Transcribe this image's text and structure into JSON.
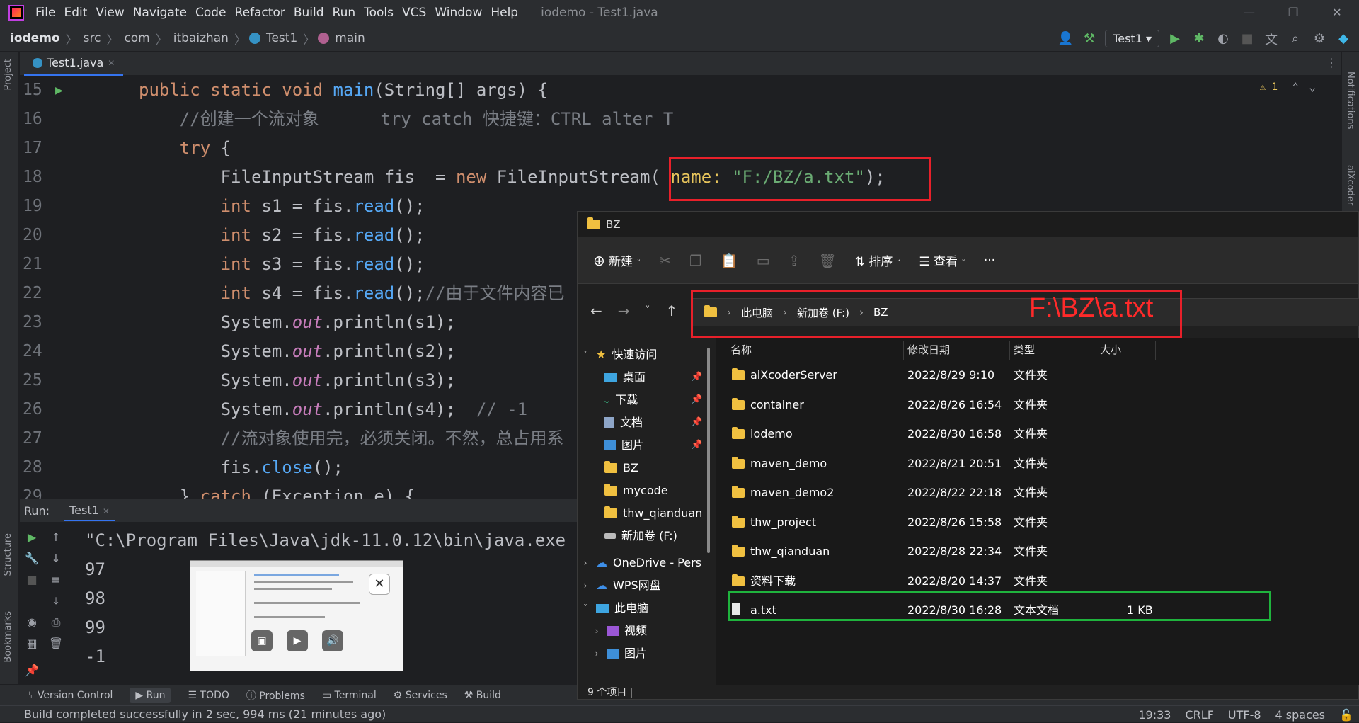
{
  "app": {
    "menu": [
      "File",
      "Edit",
      "View",
      "Navigate",
      "Code",
      "Refactor",
      "Build",
      "Run",
      "Tools",
      "VCS",
      "Window",
      "Help"
    ],
    "window_title": "iodemo - Test1.java"
  },
  "breadcrumb": [
    "iodemo",
    "src",
    "com",
    "itbaizhan",
    "Test1",
    "main"
  ],
  "run_config": "Test1",
  "left_tools": [
    "Project",
    "Structure",
    "Bookmarks"
  ],
  "right_tools": [
    "Notifications",
    "aiXcoder"
  ],
  "editor_tab": "Test1.java",
  "warnings": "1",
  "code_lines": [
    {
      "n": "15",
      "html": "<span class='k'>public static void</span> <span class='m'>main</span>(String[] args) {"
    },
    {
      "n": "16",
      "html": "    <span class='c'>//创建一个流对象      try catch 快捷键：CTRL alter T</span>"
    },
    {
      "n": "17",
      "html": "    <span class='k'>try</span> {"
    },
    {
      "n": "18",
      "html": "        FileInputStream fis  = <span class='k'>new</span> FileInputStream( <span class='hint'>name:</span> <span class='s'>\"F:/BZ/a.txt\"</span>);"
    },
    {
      "n": "19",
      "html": "        <span class='k'>int</span> s1 = fis.<span class='m'>read</span>();"
    },
    {
      "n": "20",
      "html": "        <span class='k'>int</span> s2 = fis.<span class='m'>read</span>();"
    },
    {
      "n": "21",
      "html": "        <span class='k'>int</span> s3 = fis.<span class='m'>read</span>();"
    },
    {
      "n": "22",
      "html": "        <span class='k'>int</span> s4 = fis.<span class='m'>read</span>();<span class='c'>//由于文件内容已</span>"
    },
    {
      "n": "23",
      "html": "        System.<span class='f'>out</span>.println(s1);"
    },
    {
      "n": "24",
      "html": "        System.<span class='f'>out</span>.println(s2);"
    },
    {
      "n": "25",
      "html": "        System.<span class='f'>out</span>.println(s3);"
    },
    {
      "n": "26",
      "html": "        System.<span class='f'>out</span>.println(s4);  <span class='c'>// -1</span>"
    },
    {
      "n": "27",
      "html": "        <span class='c'>//流对象使用完，必须关闭。不然，总占用系</span>"
    },
    {
      "n": "28",
      "html": "        fis.<span class='m'>close</span>();"
    },
    {
      "n": "29",
      "html": "    } <span class='k'>catch</span> (Exception e) {"
    }
  ],
  "run": {
    "label": "Run:",
    "tab": "Test1",
    "console": [
      "\"C:\\Program Files\\Java\\jdk-11.0.12\\bin\\java.exe",
      "97",
      "98",
      "99",
      "-1"
    ]
  },
  "bottom_tools": [
    "Version Control",
    "Run",
    "TODO",
    "Problems",
    "Terminal",
    "Services",
    "Build"
  ],
  "status": {
    "message": "Build completed successfully in 2 sec, 994 ms (21 minutes ago)",
    "pos": "19:33",
    "eol": "CRLF",
    "enc": "UTF-8",
    "indent": "4 spaces"
  },
  "explorer": {
    "title": "BZ",
    "cmd_new": "新建",
    "cmd_sort": "排序",
    "cmd_view": "查看",
    "address": [
      "此电脑",
      "新加卷 (F:)",
      "BZ"
    ],
    "address_annotation": "F:\\BZ\\a.txt",
    "nav": {
      "quick": "快速访问",
      "items": [
        "桌面",
        "下载",
        "文档",
        "图片",
        "BZ",
        "mycode",
        "thw_qianduan",
        "新加卷 (F:)"
      ],
      "onedrive": "OneDrive - Pers",
      "wps": "WPS网盘",
      "pc": "此电脑",
      "pc_items": [
        "视频",
        "图片"
      ]
    },
    "columns": [
      "名称",
      "修改日期",
      "类型",
      "大小"
    ],
    "rows": [
      {
        "name": "aiXcoderServer",
        "date": "2022/8/29 9:10",
        "type": "文件夹",
        "size": ""
      },
      {
        "name": "container",
        "date": "2022/8/26 16:54",
        "type": "文件夹",
        "size": ""
      },
      {
        "name": "iodemo",
        "date": "2022/8/30 16:58",
        "type": "文件夹",
        "size": ""
      },
      {
        "name": "maven_demo",
        "date": "2022/8/21 20:51",
        "type": "文件夹",
        "size": ""
      },
      {
        "name": "maven_demo2",
        "date": "2022/8/22 22:18",
        "type": "文件夹",
        "size": ""
      },
      {
        "name": "thw_project",
        "date": "2022/8/26 15:58",
        "type": "文件夹",
        "size": ""
      },
      {
        "name": "thw_qianduan",
        "date": "2022/8/28 22:34",
        "type": "文件夹",
        "size": ""
      },
      {
        "name": "资料下载",
        "date": "2022/8/20 14:37",
        "type": "文件夹",
        "size": ""
      },
      {
        "name": "a.txt",
        "date": "2022/8/30 16:28",
        "type": "文本文档",
        "size": "1 KB"
      }
    ],
    "item_count": "9 个项目"
  }
}
